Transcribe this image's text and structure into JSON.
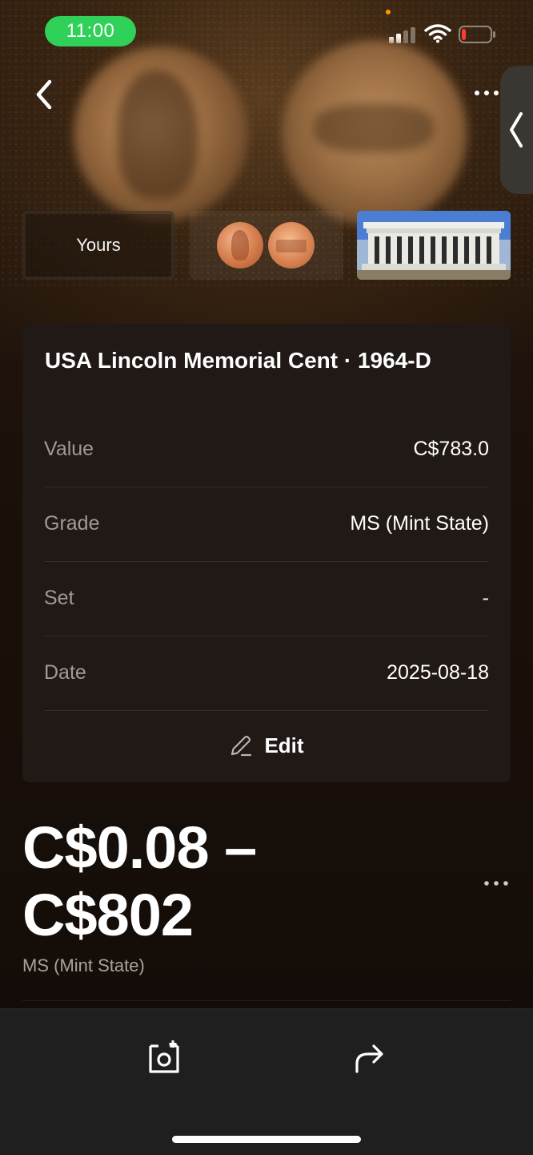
{
  "status_bar": {
    "time": "11:00",
    "time_pill_color": "#2fd158",
    "battery_level": 0.15
  },
  "thumbnails": {
    "yours_label": "Yours"
  },
  "details": {
    "title": "USA Lincoln Memorial Cent · 1964-D",
    "rows": [
      {
        "label": "Value",
        "value": "C$783.0"
      },
      {
        "label": "Grade",
        "value": "MS (Mint State)"
      },
      {
        "label": "Set",
        "value": "-"
      },
      {
        "label": "Date",
        "value": "2025-08-18"
      }
    ],
    "edit_label": "Edit"
  },
  "price": {
    "range_line1": "C$0.08 –",
    "range_line2": "C$802",
    "grade": "MS (Mint State)"
  },
  "icons": {
    "back": "chevron-left-icon",
    "more": "more-horizontal-icon",
    "side_handle": "chevron-left-icon",
    "edit": "pencil-icon",
    "scan": "camera-scan-icon",
    "share": "share-arrow-icon"
  }
}
